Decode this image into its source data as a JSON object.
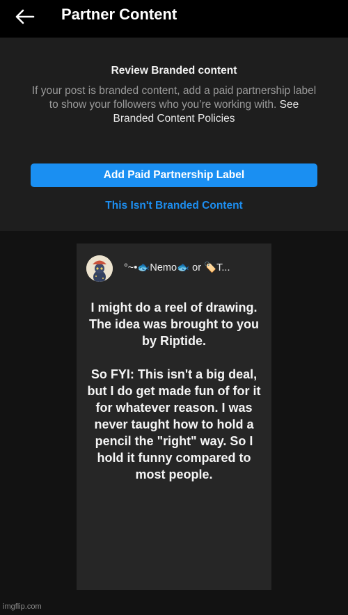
{
  "header": {
    "title": "Partner Content",
    "back_icon": "arrow-left-icon"
  },
  "review": {
    "title": "Review Branded content",
    "body": "If your post is branded content, add a paid partnership label to show your followers who you’re working with. ",
    "policy_link": "See Branded Content Policies"
  },
  "actions": {
    "primary_label": "Add Paid Partnership Label",
    "secondary_label": "This Isn't Branded Content"
  },
  "post": {
    "author": "°~•🐟Nemo🐟 or 🏷️T...",
    "text": "I might do a reel of drawing. The idea was brought to you by Riptide.\n\nSo FYI: This isn't a big deal,  but I do get made fun of for it for whatever reason. I was never taught how to hold a pencil the \"right\" way. So I hold it funny compared to most people."
  },
  "watermark": "imgflip.com",
  "colors": {
    "accent": "#1a8ff2",
    "link": "#1d8ef0",
    "background": "#121212",
    "panel": "#1e1e1e",
    "card": "#262626"
  }
}
